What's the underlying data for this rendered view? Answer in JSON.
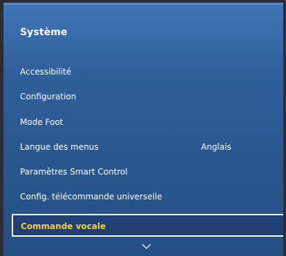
{
  "menu": {
    "title": "Système",
    "items": [
      {
        "label": "Accessibilité",
        "value": ""
      },
      {
        "label": "Configuration",
        "value": ""
      },
      {
        "label": "Mode Foot",
        "value": ""
      },
      {
        "label": "Langue des menus",
        "value": "Anglais"
      },
      {
        "label": "Paramètres Smart Control",
        "value": ""
      },
      {
        "label": "Config. télécommande universelle",
        "value": ""
      }
    ],
    "selected_item": "Commande vocale",
    "more_indicator_icon": "chevron-down-icon"
  },
  "colors": {
    "panel_blue": "#2f5f9b",
    "highlight_bg": "#203f73",
    "selected_text": "#f2d23a"
  }
}
